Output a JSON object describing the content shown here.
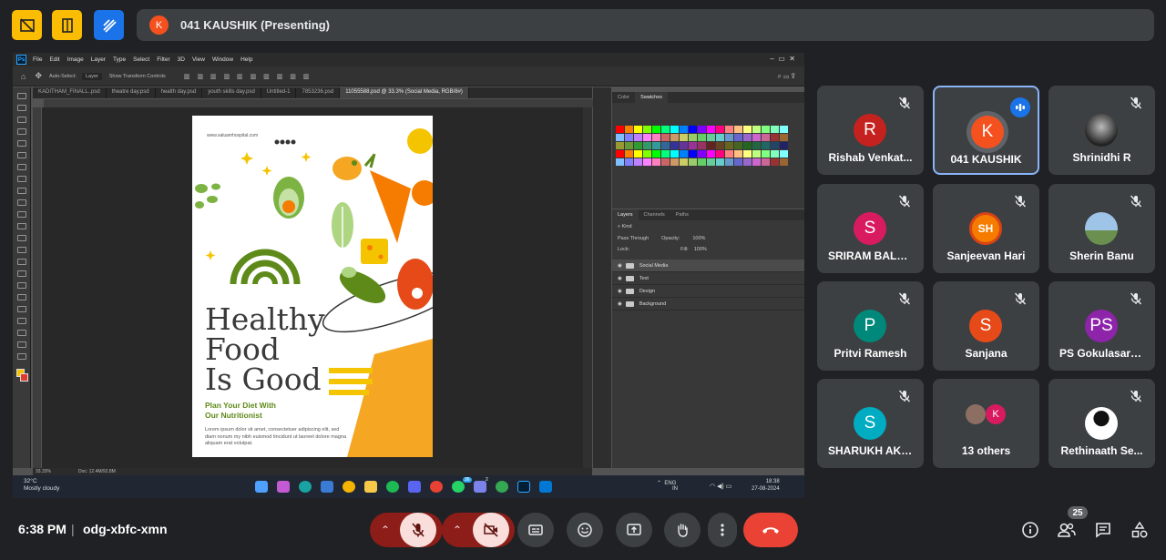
{
  "presenter": {
    "initial": "K",
    "label": "041 KAUSHIK (Presenting)"
  },
  "photoshop": {
    "menu": [
      "File",
      "Edit",
      "Image",
      "Layer",
      "Type",
      "Select",
      "Filter",
      "3D",
      "View",
      "Window",
      "Help"
    ],
    "options": {
      "auto_select": "Auto-Select:",
      "layer": "Layer",
      "transform": "Show Transform Controls"
    },
    "tabs": [
      "KADITHAM_FINALL..psd",
      "theatre day.psd",
      "health day.psd",
      "youth skills day.psd",
      "Untitled-1",
      "7853236.psd",
      "11055588.psd @ 33.3% (Social Media, RGB/8#)"
    ],
    "status": {
      "zoom": "33.33%",
      "doc": "Doc: 12.4M/92.8M"
    },
    "panel_top_tabs": [
      "Color",
      "Swatches"
    ],
    "panel_layer_tabs": [
      "Layers",
      "Channels",
      "Paths"
    ],
    "layer_kind": "Kind",
    "blend_mode": "Pass Through",
    "opacity_label": "Opacity:",
    "opacity": "100%",
    "lock_label": "Lock:",
    "fill_label": "Fill:",
    "fill": "100%",
    "layers": [
      "Social Media",
      "Text",
      "Design",
      "Background"
    ]
  },
  "poster": {
    "url": "www.saluamhospital.com",
    "title_lines": [
      "Healthy",
      "Food",
      "Is Good"
    ],
    "subtitle_lines": [
      "Plan Your Diet With",
      "Our Nutritionist"
    ],
    "lorem": "Lorem ipsum dolor sit amet, consectetuer adipiscing elit, sed diam nonum my nibh euismod tincidunt ut laoreet dolore magna aliquam erat volutpat."
  },
  "taskbar": {
    "temp": "32°C",
    "weather": "Mostly cloudy",
    "lang": "ENG",
    "region": "IN",
    "time": "18:38",
    "date": "27-08-2024",
    "badges": [
      "36",
      "2"
    ]
  },
  "participants": [
    {
      "name": "Rishab Venkat...",
      "initial": "R",
      "color": "#c5221f",
      "muted": true
    },
    {
      "name": "041 KAUSHIK",
      "initial": "K",
      "color": "#f4511e",
      "speaking": true
    },
    {
      "name": "Shrinidhi R",
      "initial": "",
      "photo": "dark",
      "muted": true
    },
    {
      "name": "SRIRAM BALA...",
      "initial": "S",
      "color": "#d81b60",
      "muted": true
    },
    {
      "name": "Sanjeevan Hari",
      "initial": "SH",
      "photo": "logo",
      "muted": true
    },
    {
      "name": "Sherin Banu",
      "initial": "",
      "photo": "sky",
      "muted": true
    },
    {
      "name": "Pritvi Ramesh",
      "initial": "P",
      "color": "#00897b",
      "muted": true
    },
    {
      "name": "Sanjana",
      "initial": "S",
      "color": "#e64a19",
      "muted": true
    },
    {
      "name": "PS Gokulasara...",
      "initial": "PS",
      "color": "#8e24aa",
      "muted": true
    },
    {
      "name": "SHARUKH AKT...",
      "initial": "S",
      "color": "#00acc1",
      "muted": true
    },
    {
      "name": "13 others",
      "initial": "K",
      "color": "#d81b60"
    },
    {
      "name": "Rethinaath Se...",
      "initial": "",
      "photo": "silhouette",
      "muted": true
    }
  ],
  "bottom": {
    "time": "6:38 PM",
    "separator": "|",
    "meeting_code": "odg-xbfc-xmn",
    "people_count": "25"
  },
  "colors": {
    "accent_blue": "#8ab4f8",
    "end_call": "#ea4335",
    "mic_off": "#f9dedc",
    "mic_bg": "#8c1d18"
  }
}
